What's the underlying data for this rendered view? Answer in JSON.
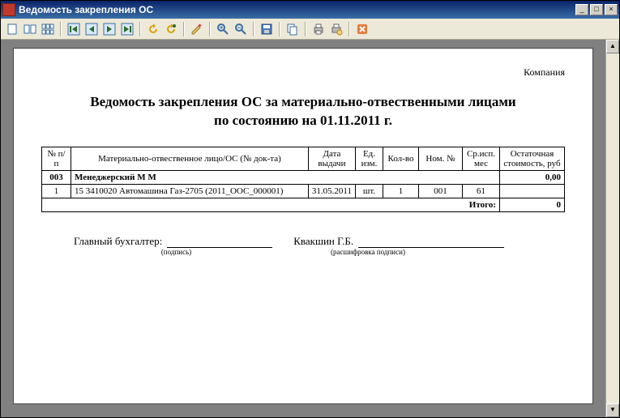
{
  "window": {
    "title": "Ведомость закрепления ОС"
  },
  "toolbar": {
    "page_single": "single-page",
    "page_dual": "dual-page",
    "nav_first": "first",
    "nav_prev": "prev",
    "nav_next": "next",
    "nav_last": "last",
    "refresh": "refresh",
    "refresh_all": "refresh-all",
    "edit": "edit",
    "zoom_in": "zoom-in",
    "zoom_out": "zoom-out",
    "save": "save",
    "copy": "copy",
    "print": "print",
    "print_preview": "print-preview",
    "close": "close"
  },
  "doc": {
    "company": "Компания",
    "title_line1": "Ведомость закрепления ОС за материально-отвественными лицами",
    "title_line2": "по состоянию на 01.11.2011 г.",
    "headers": {
      "num": "№ п/п",
      "person": "Материально-отвественное лицо/ОС (№ док-та)",
      "date": "Дата выдачи",
      "unit": "Ед. изм.",
      "qty": "Кол-во",
      "nom": "Ном. №",
      "srv": "Ср.исп. мес",
      "cost": "Остаточная стоимость, руб"
    },
    "group": {
      "code": "003",
      "name": "Менеджерский М М",
      "sum": "0,00"
    },
    "rows": [
      {
        "num": "1",
        "desc": "15 3410020   Автомашина Газ-2705 (2011_ООС_000001)",
        "date": "31.05.2011",
        "unit": "шт.",
        "qty": "1",
        "nom": "001",
        "srv": "61",
        "cost": ""
      }
    ],
    "total_label": "Итого:",
    "total_value": "0",
    "sign": {
      "role": "Главный бухгалтер:",
      "name": "Квакшин Г.Б.",
      "under1": "(подпись)",
      "under2": "(расшифровка подписи)"
    }
  }
}
